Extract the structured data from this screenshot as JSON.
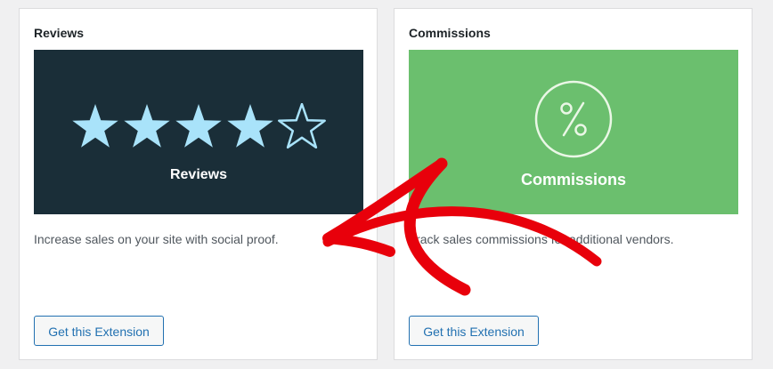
{
  "cards": [
    {
      "title": "Reviews",
      "banner_text": "Reviews",
      "banner_color": "#1a2e38",
      "banner_icon": "star-rating-icon",
      "rating": 4.5,
      "rating_max": 5,
      "star_color": "#a9e3fa",
      "description": "Increase sales on your site with social proof.",
      "button_label": "Get this Extension"
    },
    {
      "title": "Commissions",
      "banner_text": "Commissions",
      "banner_color": "#6bbf6e",
      "banner_icon": "percent-circle-icon",
      "description": "Track sales commissions for additional vendors.",
      "button_label": "Get this Extension"
    }
  ],
  "annotation": {
    "icon": "red-arrow-icon",
    "color": "#e8000b",
    "points_to": "Reviews"
  }
}
